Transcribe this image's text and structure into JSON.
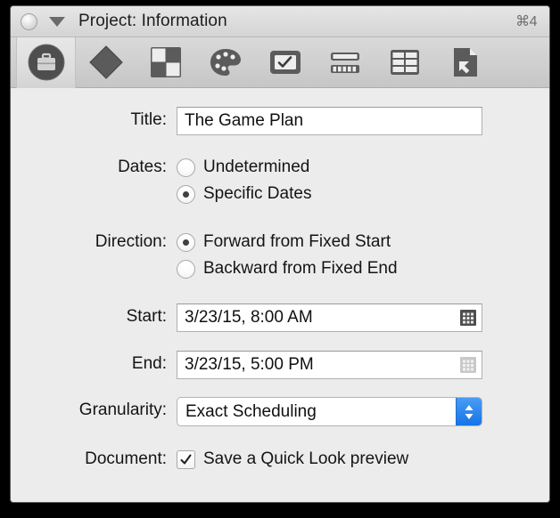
{
  "window": {
    "title": "Project: Information",
    "shortcut": "⌘4",
    "close_button_name": "close-orb",
    "disclosure_name": "disclosure-triangle"
  },
  "toolbar": {
    "items": [
      {
        "name": "tab-project",
        "icon": "briefcase-icon",
        "selected": true
      },
      {
        "name": "tab-task",
        "icon": "diamond-icon",
        "selected": false
      },
      {
        "name": "tab-assignments",
        "icon": "checkerboard-icon",
        "selected": false
      },
      {
        "name": "tab-styles",
        "icon": "palette-icon",
        "selected": false
      },
      {
        "name": "tab-form",
        "icon": "checkbox-in-frame-icon",
        "selected": false
      },
      {
        "name": "tab-chart",
        "icon": "bar-levels-icon",
        "selected": false
      },
      {
        "name": "tab-table",
        "icon": "table-grid-icon",
        "selected": false
      },
      {
        "name": "tab-attachment",
        "icon": "document-arrow-icon",
        "selected": false
      }
    ]
  },
  "form": {
    "title": {
      "label": "Title:",
      "value": "The Game Plan",
      "placeholder": ""
    },
    "dates": {
      "label": "Dates:",
      "options": [
        {
          "label": "Undetermined",
          "selected": false
        },
        {
          "label": "Specific Dates",
          "selected": true
        }
      ]
    },
    "direction": {
      "label": "Direction:",
      "options": [
        {
          "label": "Forward from Fixed Start",
          "selected": true
        },
        {
          "label": "Backward from Fixed End",
          "selected": false
        }
      ]
    },
    "start": {
      "label": "Start:",
      "value": "3/23/15, 8:00 AM",
      "picker_icon": "calendar-grid-icon",
      "picker_enabled": true
    },
    "end": {
      "label": "End:",
      "value": "3/23/15, 5:00 PM",
      "picker_icon": "calendar-grid-icon",
      "picker_enabled": false
    },
    "granularity": {
      "label": "Granularity:",
      "value": "Exact Scheduling",
      "arrows_icon": "chevron-up-down-icon"
    },
    "document": {
      "label": "Document:",
      "checkbox_label": "Save a Quick Look preview",
      "checked": true,
      "check_icon": "checkmark-icon"
    }
  },
  "colors": {
    "accent": "#1574e6",
    "window_bg": "#ececec",
    "titlebar_bg": "#d9d9d9",
    "toolbar_bg": "#cfcfcf",
    "text": "#141414",
    "field_bg": "#ffffff",
    "border": "#b0b0b0",
    "icon_dark": "#5a5a5a",
    "icon_disabled": "#b6b6b6"
  }
}
